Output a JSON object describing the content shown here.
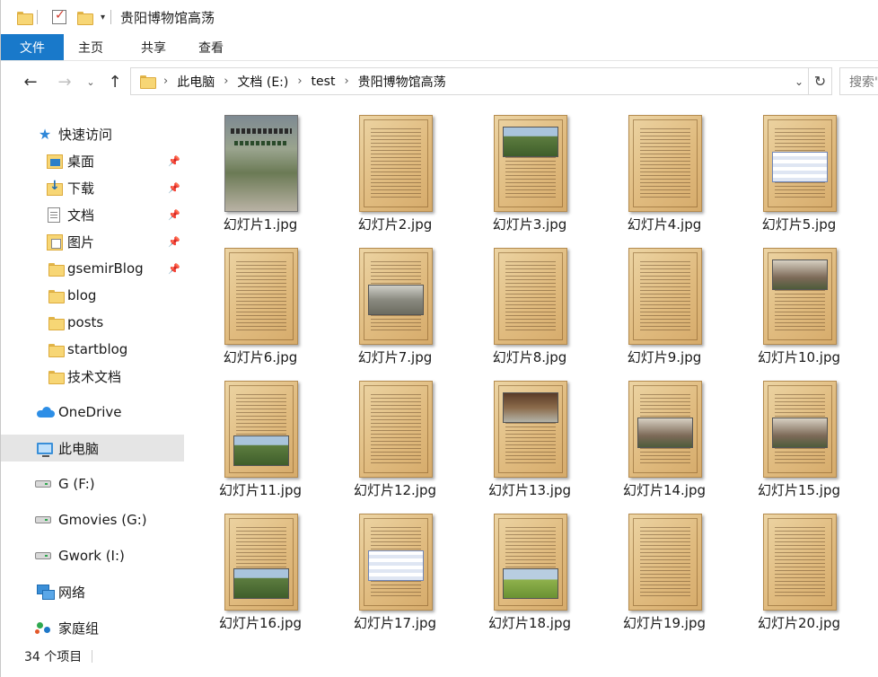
{
  "window": {
    "title": "贵阳博物馆高荡",
    "quick_access_dropdown_glyph": "▾"
  },
  "ribbon": {
    "tabs": [
      "文件",
      "主页",
      "共享",
      "查看"
    ]
  },
  "address": {
    "crumbs": [
      "此电脑",
      "文档 (E:)",
      "test",
      "贵阳博物馆高荡"
    ],
    "search_placeholder": "搜索\"贵阳博物馆高荡\""
  },
  "navpane": {
    "quick_access_label": "快速访问",
    "items": [
      {
        "label": "快速访问",
        "icon": "star-icon",
        "pinned": false,
        "level": 0
      },
      {
        "label": "桌面",
        "icon": "desktop-folder-icon",
        "pinned": true,
        "level": 1
      },
      {
        "label": "下载",
        "icon": "downloads-folder-icon",
        "pinned": true,
        "level": 1
      },
      {
        "label": "文档",
        "icon": "documents-icon",
        "pinned": true,
        "level": 1
      },
      {
        "label": "图片",
        "icon": "pictures-folder-icon",
        "pinned": true,
        "level": 1
      },
      {
        "label": "gsemirBlog",
        "icon": "folder-icon",
        "pinned": true,
        "level": 1
      },
      {
        "label": "blog",
        "icon": "folder-icon",
        "pinned": false,
        "level": 1
      },
      {
        "label": "posts",
        "icon": "folder-icon",
        "pinned": false,
        "level": 1
      },
      {
        "label": "startblog",
        "icon": "folder-icon",
        "pinned": false,
        "level": 1
      },
      {
        "label": "技术文档",
        "icon": "folder-icon",
        "pinned": false,
        "level": 1
      },
      {
        "label": "OneDrive",
        "icon": "onedrive-cloud-icon",
        "pinned": false,
        "level": 0
      },
      {
        "label": "此电脑",
        "icon": "this-pc-icon",
        "pinned": false,
        "level": 0,
        "selected": true
      },
      {
        "label": "G (F:)",
        "icon": "drive-icon",
        "pinned": false,
        "level": 0
      },
      {
        "label": "Gmovies (G:)",
        "icon": "drive-icon",
        "pinned": false,
        "level": 0
      },
      {
        "label": "Gwork (I:)",
        "icon": "drive-icon",
        "pinned": false,
        "level": 0
      },
      {
        "label": "网络",
        "icon": "network-icon",
        "pinned": false,
        "level": 0
      },
      {
        "label": "家庭组",
        "icon": "homegroup-icon",
        "pinned": false,
        "level": 0
      }
    ]
  },
  "files": [
    {
      "name": "幻灯片1.jpg",
      "kind": "cover"
    },
    {
      "name": "幻灯片2.jpg",
      "kind": "text"
    },
    {
      "name": "幻灯片3.jpg",
      "kind": "photo-top",
      "photo": "green"
    },
    {
      "name": "幻灯片4.jpg",
      "kind": "text"
    },
    {
      "name": "幻灯片5.jpg",
      "kind": "photo-mid",
      "photo": "table"
    },
    {
      "name": "幻灯片6.jpg",
      "kind": "text"
    },
    {
      "name": "幻灯片7.jpg",
      "kind": "photo-mid",
      "photo": "stone"
    },
    {
      "name": "幻灯片8.jpg",
      "kind": "text"
    },
    {
      "name": "幻灯片9.jpg",
      "kind": "text"
    },
    {
      "name": "幻灯片10.jpg",
      "kind": "photo-top",
      "photo": "house"
    },
    {
      "name": "幻灯片11.jpg",
      "kind": "photo-bottom",
      "photo": "green"
    },
    {
      "name": "幻灯片12.jpg",
      "kind": "text"
    },
    {
      "name": "幻灯片13.jpg",
      "kind": "photo-top",
      "photo": "gate"
    },
    {
      "name": "幻灯片14.jpg",
      "kind": "photo-mid",
      "photo": "house"
    },
    {
      "name": "幻灯片15.jpg",
      "kind": "photo-mid",
      "photo": "house"
    },
    {
      "name": "幻灯片16.jpg",
      "kind": "photo-bottom",
      "photo": "green"
    },
    {
      "name": "幻灯片17.jpg",
      "kind": "photo-mid",
      "photo": "table"
    },
    {
      "name": "幻灯片18.jpg",
      "kind": "photo-bottom",
      "photo": "field"
    },
    {
      "name": "幻灯片19.jpg",
      "kind": "text"
    },
    {
      "name": "幻灯片20.jpg",
      "kind": "text"
    }
  ],
  "status": {
    "item_count": "34 个项目"
  },
  "colors": {
    "file_tab": "#1979ca",
    "selected_nav": "#e5e5e5",
    "parchment": "#e0bb7f"
  }
}
